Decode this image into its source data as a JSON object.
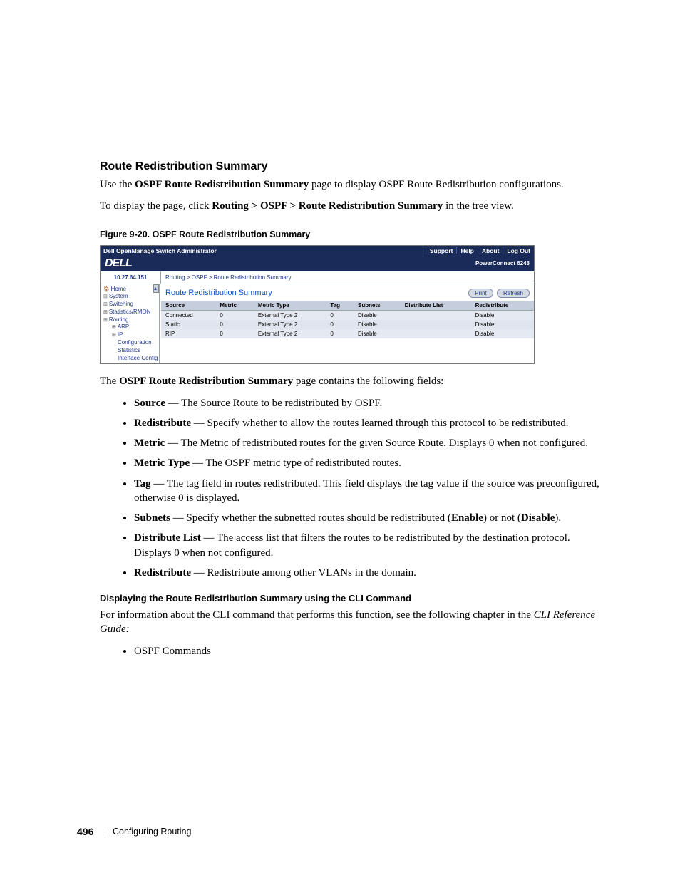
{
  "section": {
    "title": "Route Redistribution Summary",
    "intro_prefix": "Use the ",
    "intro_bold": "OSPF Route Redistribution Summary",
    "intro_suffix": " page to display OSPF Route Redistribution configurations.",
    "nav_prefix": "To display the page, click ",
    "nav_bold": "Routing > OSPF > Route Redistribution Summary",
    "nav_suffix": " in the tree view."
  },
  "figure": {
    "caption": "Figure 9-20.   OSPF Route Redistribution Summary"
  },
  "app": {
    "top_title": "Dell OpenManage Switch Administrator",
    "top_links": [
      "Support",
      "Help",
      "About",
      "Log Out"
    ],
    "logo": "DELL",
    "model": "PowerConnect 6248",
    "ip": "10.27.64.151",
    "tree": {
      "home": "Home",
      "system": "System",
      "switching": "Switching",
      "stats": "Statistics/RMON",
      "routing": "Routing",
      "arp": "ARP",
      "ip": "IP",
      "cfg": "Configuration",
      "stat": "Statistics",
      "ifc": "Interface Config"
    },
    "breadcrumb": "Routing > OSPF > Route Redistribution Summary",
    "panel_title": "Route Redistribution Summary",
    "buttons": {
      "print": "Print",
      "refresh": "Refresh"
    },
    "columns": [
      "Source",
      "Metric",
      "Metric Type",
      "Tag",
      "Subnets",
      "Distribute List",
      "Redistribute"
    ],
    "rows": [
      {
        "source": "Connected",
        "metric": "0",
        "mtype": "External Type 2",
        "tag": "0",
        "subnets": "Disable",
        "dlist": "",
        "redist": "Disable"
      },
      {
        "source": "Static",
        "metric": "0",
        "mtype": "External Type 2",
        "tag": "0",
        "subnets": "Disable",
        "dlist": "",
        "redist": "Disable"
      },
      {
        "source": "RIP",
        "metric": "0",
        "mtype": "External Type 2",
        "tag": "0",
        "subnets": "Disable",
        "dlist": "",
        "redist": "Disable"
      }
    ]
  },
  "after_figure_prefix": "The ",
  "after_figure_bold": "OSPF Route Redistribution Summary",
  "after_figure_suffix": " page contains the following fields:",
  "fields": [
    {
      "name": "Source",
      "desc": " — The Source Route to be redistributed by OSPF."
    },
    {
      "name": "Redistribute",
      "desc": " — Specify whether to allow the routes learned through this protocol to be redistributed."
    },
    {
      "name": "Metric",
      "desc": " — The Metric of redistributed routes for the given Source Route. Displays 0 when not configured."
    },
    {
      "name": "Metric Type",
      "desc": " — The OSPF metric type of redistributed routes."
    },
    {
      "name": "Tag",
      "desc": " — The tag field in routes redistributed. This field displays the tag value if the source was preconfigured, otherwise 0 is displayed."
    },
    {
      "name": "Subnets",
      "desc_pre": " — Specify whether the subnetted routes should be redistributed (",
      "b1": "Enable",
      "mid": ") or not (",
      "b2": "Disable",
      "end": ")."
    },
    {
      "name": "Distribute List",
      "desc": " — The access list that filters the routes to be redistributed by the destination protocol. Displays 0 when not configured."
    },
    {
      "name": "Redistribute",
      "desc": " — Redistribute among other VLANs in the domain."
    }
  ],
  "cli": {
    "heading": "Displaying the Route Redistribution Summary using the CLI Command",
    "text_prefix": "For information about the CLI command that performs this function, see the following chapter in the ",
    "text_italic": "CLI Reference Guide:",
    "item": "OSPF Commands"
  },
  "footer": {
    "page": "496",
    "sep": "|",
    "chapter": "Configuring Routing"
  }
}
